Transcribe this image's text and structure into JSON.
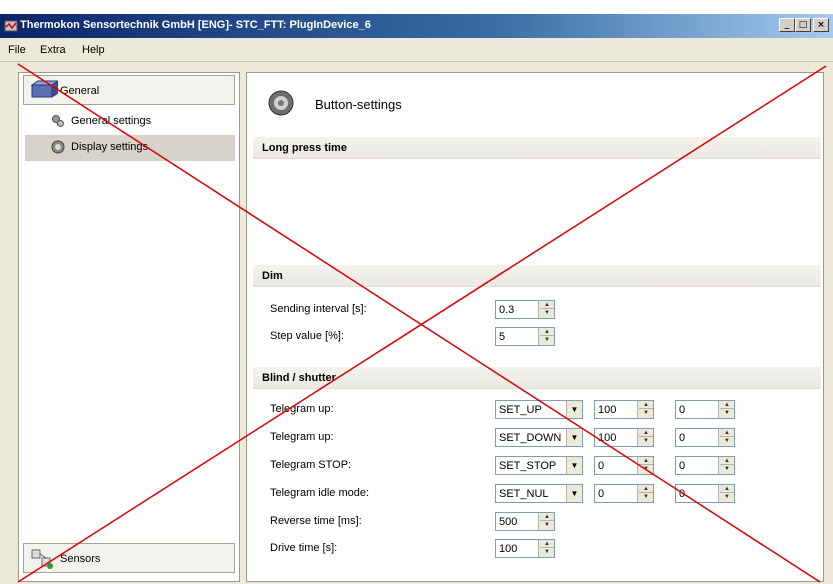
{
  "window": {
    "title": "Thermokon Sensortechnik GmbH [ENG]- STC_FTT: PlugInDevice_6",
    "min_label": "_",
    "max_label": "□",
    "close_label": "×"
  },
  "menu": {
    "file": "File",
    "extra": "Extra",
    "help": "Help"
  },
  "sidebar": {
    "header": "General",
    "items": [
      {
        "label": "General settings"
      },
      {
        "label": "Display settings"
      }
    ],
    "footer": "Sensors"
  },
  "main": {
    "title": "Button-settings",
    "sections": {
      "long_press": "Long press time",
      "dim": "Dim",
      "blind": "Blind / shutter"
    },
    "dim": {
      "sending_interval_label": "Sending interval [s]:",
      "sending_interval_value": "0.3",
      "step_value_label": "Step value [%]:",
      "step_value_value": "5"
    },
    "blind": {
      "rows": [
        {
          "label": "Telegram up:",
          "select": "SET_UP",
          "v1": "100",
          "v2": "0"
        },
        {
          "label": "Telegram up:",
          "select": "SET_DOWN",
          "v1": "100",
          "v2": "0"
        },
        {
          "label": "Telegram STOP:",
          "select": "SET_STOP",
          "v1": "0",
          "v2": "0"
        },
        {
          "label": "Telegram idle mode:",
          "select": "SET_NUL",
          "v1": "0",
          "v2": "0"
        }
      ],
      "reverse_time_label": "Reverse time [ms]:",
      "reverse_time_value": "500",
      "drive_time_label": "Drive time [s]:",
      "drive_time_value": "100"
    }
  },
  "colors": {
    "cross": "#e00000",
    "titlebar": "#0a246a",
    "selected": "#d6d3cb"
  },
  "arrows": {
    "up": "▲",
    "down": "▼",
    "drop": "▼"
  }
}
